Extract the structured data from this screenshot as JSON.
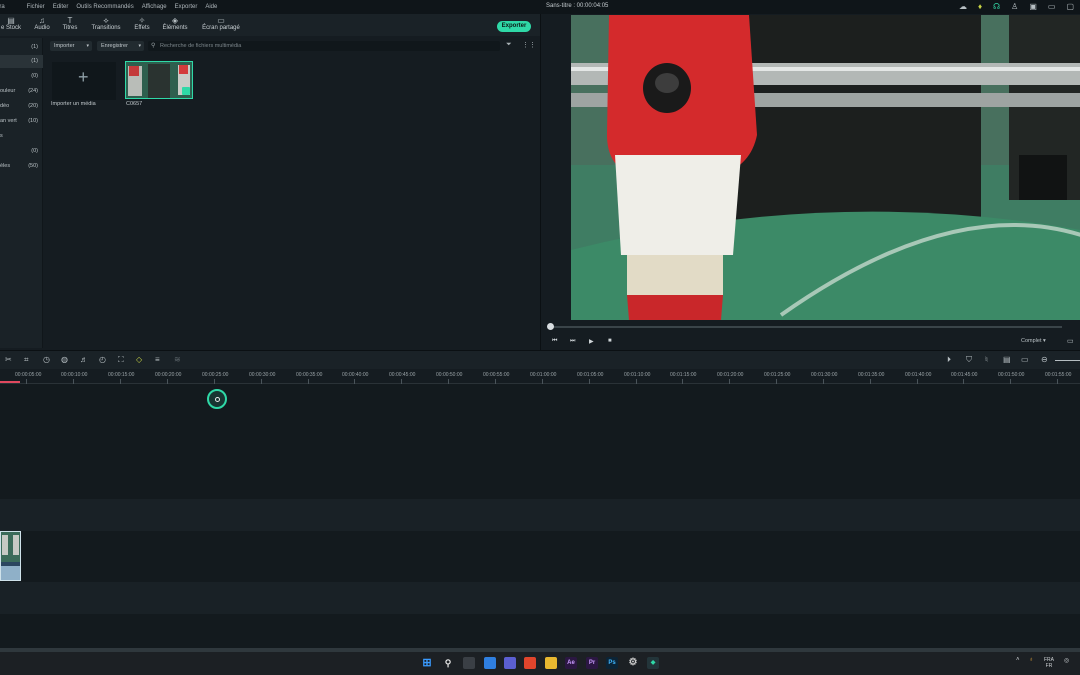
{
  "menubar": {
    "app_name": "era",
    "items": [
      "Fichier",
      "Editer",
      "Outils Recommandés",
      "Affichage",
      "Exporter",
      "Aide"
    ],
    "document_title": "Sans-titre : 00:00:04:05"
  },
  "toolbar": {
    "tabs": [
      {
        "label": "e Stock",
        "icon": "stock-icon"
      },
      {
        "label": "Audio",
        "icon": "music-icon"
      },
      {
        "label": "Titres",
        "icon": "text-icon"
      },
      {
        "label": "Transitions",
        "icon": "transition-icon"
      },
      {
        "label": "Effets",
        "icon": "effects-icon"
      },
      {
        "label": "Éléments",
        "icon": "elements-icon"
      },
      {
        "label": "Écran partagé",
        "icon": "split-screen-icon"
      }
    ],
    "export_label": "Exporter"
  },
  "sidebar": {
    "items": [
      {
        "label": "",
        "count": "(1)"
      },
      {
        "label": "",
        "count": "(1)"
      },
      {
        "label": "",
        "count": "(0)"
      },
      {
        "label": "ouleur",
        "count": "(24)"
      },
      {
        "label": "déo",
        "count": "(20)"
      },
      {
        "label": "an vert",
        "count": "(10)"
      },
      {
        "label": "s",
        "count": ""
      },
      {
        "label": "",
        "count": "(0)"
      },
      {
        "label": "èles",
        "count": "(50)"
      }
    ]
  },
  "media": {
    "import_dropdown": "Importer",
    "save_dropdown": "Enregistrer",
    "search_placeholder": "Recherche de fichiers multimédia",
    "import_tile_label": "Importer un média",
    "clip_label": "C0657"
  },
  "player": {
    "quality_label": "Complet"
  },
  "ruler": {
    "ticks": [
      "00:00:05:00",
      "00:00:10:00",
      "00:00:15:00",
      "00:00:20:00",
      "00:00:25:00",
      "00:00:30:00",
      "00:00:35:00",
      "00:00:40:00",
      "00:00:45:00",
      "00:00:50:00",
      "00:00:55:00",
      "00:01:00:00",
      "00:01:05:00",
      "00:01:10:00",
      "00:01:15:00",
      "00:01:20:00",
      "00:01:25:00",
      "00:01:30:00",
      "00:01:35:00",
      "00:01:40:00",
      "00:01:45:00",
      "00:01:50:00",
      "00:01:55:00"
    ]
  },
  "taskbar": {
    "lang_top": "FRA",
    "lang_bottom": "FR"
  },
  "colors": {
    "accent": "#2fd9a7",
    "panel": "#1a2227",
    "background": "#151c21"
  }
}
